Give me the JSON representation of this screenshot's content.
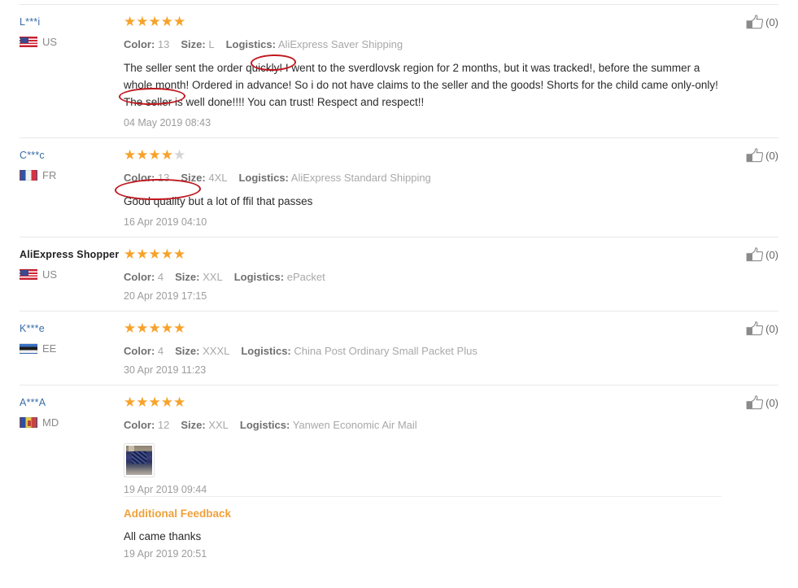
{
  "labels": {
    "color": "Color:",
    "size": "Size:",
    "logistics": "Logistics:",
    "additional_feedback": "Additional Feedback"
  },
  "colors": {
    "star_filled": "#f7a22b",
    "star_empty": "#d4d4d4",
    "username_link": "#3a6ea5",
    "muted_text": "#9a9a9a",
    "accent_orange": "#f0a13a",
    "annotation_red": "#c0181f",
    "divider": "#e8e8e8"
  },
  "reviews": [
    {
      "username": "L***i",
      "country_code": "US",
      "flag": "flag-us-icon",
      "rating": 5,
      "color": "13",
      "size": "L",
      "logistics": "AliExpress Saver Shipping",
      "text": "The seller sent the order quickly! I went to the sverdlovsk region for 2 months, but it was tracked!, before the summer a whole month! Ordered in advance! So i do not have claims to the seller and the goods! Shorts for the child came only-only! The seller is well done!!!! You can trust! Respect and respect!!",
      "date": "04 May 2019 08:43",
      "helpful_count": "(0)",
      "has_image": false
    },
    {
      "username": "C***c",
      "country_code": "FR",
      "flag": "flag-fr-icon",
      "rating": 4,
      "color": "13",
      "size": "4XL",
      "logistics": "AliExpress Standard Shipping",
      "text": "Good quality but a lot of ffil that passes",
      "date": "16 Apr 2019 04:10",
      "helpful_count": "(0)",
      "has_image": false
    },
    {
      "username": "AliExpress Shopper",
      "country_code": "US",
      "flag": "flag-us-icon",
      "rating": 5,
      "color": "4",
      "size": "XXL",
      "logistics": "ePacket",
      "text": "",
      "date": "20 Apr 2019 17:15",
      "helpful_count": "(0)",
      "has_image": false
    },
    {
      "username": "K***e",
      "country_code": "EE",
      "flag": "flag-ee-icon",
      "rating": 5,
      "color": "4",
      "size": "XXXL",
      "logistics": "China Post Ordinary Small Packet Plus",
      "text": "",
      "date": "30 Apr 2019 11:23",
      "helpful_count": "(0)",
      "has_image": false
    },
    {
      "username": "A***A",
      "country_code": "MD",
      "flag": "flag-md-icon",
      "rating": 5,
      "color": "12",
      "size": "XXL",
      "logistics": "Yanwen Economic Air Mail",
      "text": "",
      "date": "19 Apr 2019 09:44",
      "helpful_count": "(0)",
      "has_image": true,
      "additional_feedback": {
        "title": "Additional Feedback",
        "text": "All came thanks",
        "date": "19 Apr 2019 20:51"
      }
    }
  ],
  "annotations": [
    {
      "id": "annot-quickly",
      "target_text": "quickly!",
      "shape": "ellipse",
      "color": "#c0181f"
    },
    {
      "id": "annot-welldone",
      "target_text": "well done!!!!",
      "shape": "ellipse",
      "color": "#c0181f"
    },
    {
      "id": "annot-goodq",
      "target_text": "Good quality",
      "shape": "ellipse",
      "color": "#c0181f"
    }
  ]
}
